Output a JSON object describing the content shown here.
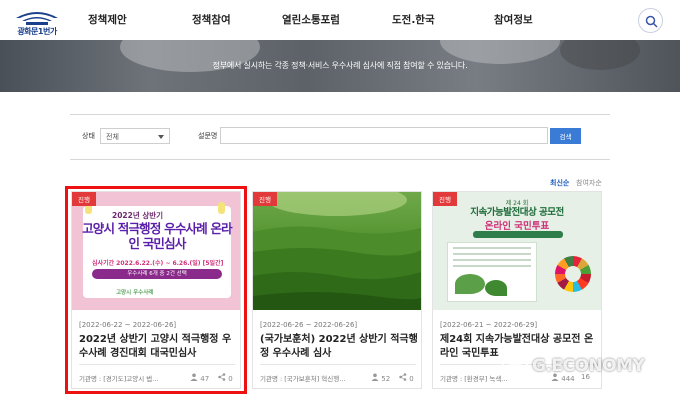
{
  "header": {
    "logo_text": "광화문1번가",
    "nav": [
      "정책제안",
      "정책참여",
      "열린소통포럼",
      "도전.한국",
      "참여정보"
    ]
  },
  "banner": {
    "text": "정부에서 실시하는 각종 정책·서비스 우수사례 심사에 직접 참여할 수 있습니다."
  },
  "filter": {
    "status_label": "상태",
    "status_value": "전체",
    "survey_label": "설문명",
    "search_button": "검색"
  },
  "sort": {
    "active": "최신순",
    "other": "참여자순"
  },
  "cards": [
    {
      "tag": "진행",
      "date": "[2022-06-22 ~ 2022-06-26]",
      "title": "2022년 상반기 고양시 적극행정 우수사례 경진대회 대국민심사",
      "org": "기관명 : [경기도]고양시 법...",
      "likes": "47",
      "shares": "0",
      "thumb": {
        "sub": "2022년 상반기",
        "big": "고양시 적극행정 우수사례 온라인 국민심사",
        "period": "심사기간 2022.6.22.(수) ~ 6.26.(일) [5일간]",
        "pill": "우수사례 6개 중 2건 선택",
        "small": "고양시 우수사례"
      }
    },
    {
      "tag": "진행",
      "date": "[2022-06-26 ~ 2022-06-26]",
      "title": "(국가보훈처) 2022년 상반기 적극행정 우수사례 심사",
      "org": "기관명 : [국가보훈처] 혁신행...",
      "likes": "52",
      "shares": "0"
    },
    {
      "tag": "진행",
      "date": "[2022-06-21 ~ 2022-06-29]",
      "title": "제24회 지속가능발전대상 공모전 온라인 국민투표",
      "org": "기관명 : [환경부] 녹색...",
      "likes": "444",
      "shares": "16",
      "thumb": {
        "line1": "제 24 회",
        "line2": "지속가능발전대상 공모전",
        "line3": "온라인 국민투표",
        "period": "투표기간 : 6. 21(화) ~ 06. 29"
      }
    }
  ],
  "watermark": "G.ECONOMY",
  "colors": {
    "accent": "#3a7bd5",
    "tag": "#e23a3a",
    "highlight": "#e11111"
  }
}
